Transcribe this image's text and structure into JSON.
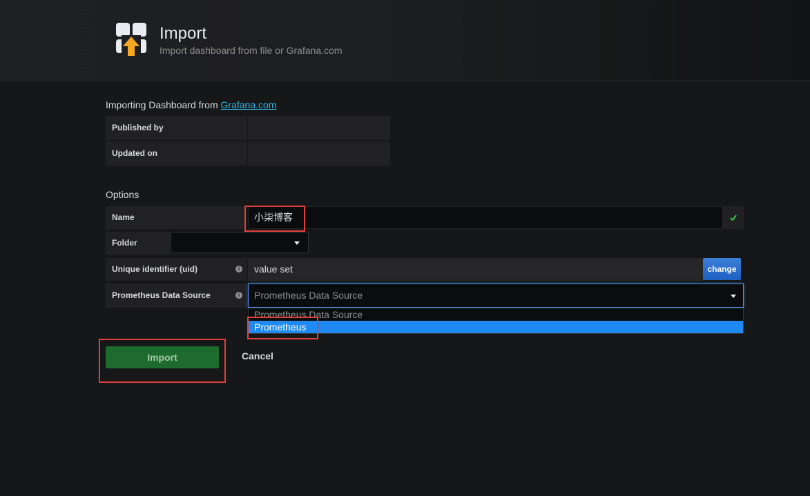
{
  "header": {
    "title": "Import",
    "subtitle": "Import dashboard from file or Grafana.com",
    "icon": "dashboard-import-icon"
  },
  "source": {
    "heading_prefix": "Importing Dashboard from",
    "link_text": "Grafana.com",
    "rows": [
      {
        "label": "Published by",
        "value": ""
      },
      {
        "label": "Updated on",
        "value": ""
      }
    ]
  },
  "options": {
    "heading": "Options",
    "name": {
      "label": "Name",
      "value": "小柒博客"
    },
    "folder": {
      "label": "Folder",
      "value": ""
    },
    "uid": {
      "label": "Unique identifier (uid)",
      "value": "value set",
      "change_label": "change"
    },
    "datasource": {
      "label": "Prometheus Data Source",
      "placeholder": "Prometheus Data Source",
      "options": [
        "Prometheus Data Source",
        "Prometheus"
      ],
      "highlighted": "Prometheus"
    }
  },
  "actions": {
    "import_label": "Import",
    "cancel_label": "Cancel"
  },
  "colors": {
    "background": "#161719",
    "panel": "#212124",
    "input": "#0b0c0e",
    "accent_blue": "#1f8af2",
    "link": "#33b5e5",
    "success": "#1e6b2e",
    "check": "#2ecc40",
    "annotation": "#e2403a"
  }
}
